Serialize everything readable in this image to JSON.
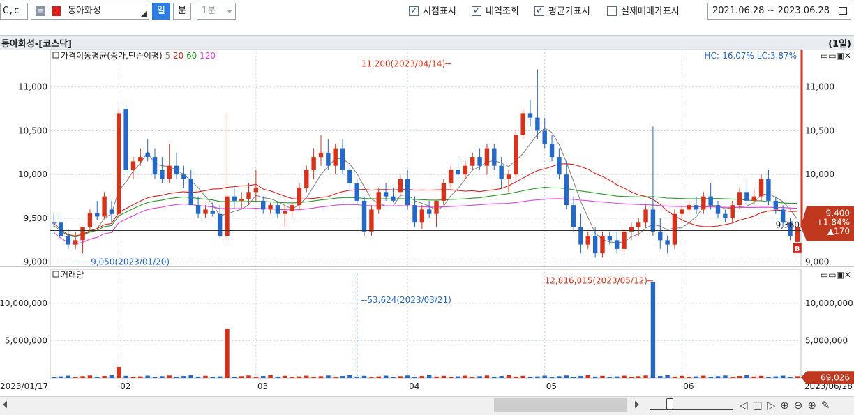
{
  "toolbar": {
    "code": "C,c",
    "stock_name": "동아화성",
    "btn_day": "일",
    "btn_min": "분",
    "interval": "1분",
    "checks": [
      {
        "label": "시점표시",
        "checked": true
      },
      {
        "label": "내역조회",
        "checked": true
      },
      {
        "label": "평균가표시",
        "checked": true
      },
      {
        "label": "실제매매가표시",
        "checked": false
      }
    ],
    "date_range": "2021.06.28 ~ 2023.06.28"
  },
  "panel": {
    "title": "동아화성-[코스닥]",
    "period": "(1일)"
  },
  "colors": {
    "up": "#d6331c",
    "down": "#2468c8",
    "ma5": "#888888",
    "ma20": "#e02020",
    "ma60": "#2a9a2a",
    "ma120": "#e040e0",
    "accent": "#e8542a"
  },
  "chart_data": [
    {
      "type": "candlestick",
      "title": "",
      "legend_title": "가격이동평균(종가,단순이평)",
      "ma_periods": [
        "5",
        "20",
        "60",
        "120"
      ],
      "hc_lc": "HC:-16.07%  LC:3.87%",
      "y_ticks": [
        9000,
        9500,
        10000,
        10500,
        11000
      ],
      "y_tick_labels": [
        "9,000",
        "9,500",
        "10,000",
        "10,500",
        "11,000"
      ],
      "ylim": [
        8950,
        11420
      ],
      "x_start_label": "2023/01/17",
      "x_end_label": "2023/06/28",
      "month_labels": [
        {
          "label": "02",
          "idx": 9
        },
        {
          "label": "03",
          "idx": 28
        },
        {
          "label": "04",
          "idx": 49
        },
        {
          "label": "05",
          "idx": 68
        },
        {
          "label": "06",
          "idx": 87
        }
      ],
      "n_bars": 104,
      "max_annotation": {
        "text": "11,200(2023/04/14)",
        "idx": 55,
        "value": 11200
      },
      "min_annotation": {
        "text": "9,050(2023/01/20)",
        "idx": 3,
        "value": 9050
      },
      "last_price_label": "9,360",
      "last_price": 9360,
      "current_box": [
        "9,400",
        "+1.84%",
        "▲170"
      ],
      "current_price": 9400,
      "buy_marker": "B",
      "candles": [
        [
          9450,
          9550,
          9400,
          9440
        ],
        [
          9450,
          9550,
          9260,
          9300
        ],
        [
          9300,
          9380,
          9150,
          9200
        ],
        [
          9200,
          9350,
          9150,
          9250
        ],
        [
          9250,
          9400,
          9100,
          9400
        ],
        [
          9400,
          9600,
          9350,
          9560
        ],
        [
          9560,
          9700,
          9480,
          9520
        ],
        [
          9520,
          9800,
          9500,
          9750
        ],
        [
          9600,
          9700,
          9450,
          9550
        ],
        [
          9550,
          10750,
          9500,
          10700
        ],
        [
          10750,
          10800,
          10000,
          10050
        ],
        [
          10050,
          10200,
          9950,
          10150
        ],
        [
          10150,
          10300,
          10100,
          10200
        ],
        [
          10250,
          10400,
          10150,
          10200
        ],
        [
          10200,
          10300,
          9950,
          10000
        ],
        [
          10050,
          10200,
          9900,
          9950
        ],
        [
          9950,
          10350,
          9900,
          10100
        ],
        [
          10100,
          10250,
          9950,
          10000
        ],
        [
          10000,
          10100,
          9850,
          9950
        ],
        [
          9950,
          10050,
          9750,
          9650
        ],
        [
          9650,
          9750,
          9500,
          9550
        ],
        [
          9550,
          9650,
          9500,
          9600
        ],
        [
          9580,
          9680,
          9520,
          9550
        ],
        [
          9550,
          9650,
          9280,
          9300
        ],
        [
          9300,
          10700,
          9250,
          9750
        ],
        [
          9750,
          9850,
          9600,
          9700
        ],
        [
          9700,
          9800,
          9600,
          9720
        ],
        [
          9720,
          9900,
          9650,
          9800
        ],
        [
          9800,
          10050,
          9700,
          9850
        ],
        [
          9700,
          9750,
          9550,
          9600
        ],
        [
          9600,
          9680,
          9550,
          9650
        ],
        [
          9650,
          9700,
          9500,
          9550
        ],
        [
          9550,
          9650,
          9400,
          9580
        ],
        [
          9580,
          9700,
          9500,
          9650
        ],
        [
          9650,
          9900,
          9600,
          9850
        ],
        [
          9850,
          10100,
          9800,
          10050
        ],
        [
          10050,
          10300,
          9950,
          10200
        ],
        [
          10200,
          10450,
          10100,
          10250
        ],
        [
          10250,
          10400,
          10050,
          10100
        ],
        [
          10100,
          10350,
          10000,
          10300
        ],
        [
          10300,
          10400,
          10000,
          10050
        ],
        [
          10050,
          10100,
          9800,
          9900
        ],
        [
          9900,
          9950,
          9650,
          9700
        ],
        [
          9700,
          9750,
          9300,
          9350
        ],
        [
          9350,
          9650,
          9300,
          9600
        ],
        [
          9600,
          9850,
          9550,
          9800
        ],
        [
          9800,
          9900,
          9700,
          9750
        ],
        [
          9750,
          9850,
          9680,
          9700
        ],
        [
          9800,
          10000,
          9750,
          9950
        ],
        [
          9950,
          10050,
          9600,
          9650
        ],
        [
          9650,
          9750,
          9400,
          9450
        ],
        [
          9450,
          9650,
          9380,
          9600
        ],
        [
          9600,
          9700,
          9500,
          9550
        ],
        [
          9550,
          9700,
          9400,
          9700
        ],
        [
          9700,
          9950,
          9650,
          9900
        ],
        [
          9900,
          10100,
          9850,
          10050
        ],
        [
          10050,
          10200,
          9950,
          10000
        ],
        [
          10000,
          10150,
          9950,
          10100
        ],
        [
          10100,
          10250,
          10050,
          10200
        ],
        [
          10200,
          10300,
          10050,
          10100
        ],
        [
          10100,
          10350,
          10000,
          10300
        ],
        [
          10300,
          10350,
          10050,
          10100
        ],
        [
          10100,
          10200,
          9850,
          9950
        ],
        [
          9950,
          10050,
          9800,
          10000
        ],
        [
          10000,
          10500,
          9950,
          10450
        ],
        [
          10450,
          10750,
          10400,
          10700
        ],
        [
          10700,
          10850,
          10550,
          10650
        ],
        [
          10650,
          11200,
          10400,
          10500
        ],
        [
          10500,
          10650,
          10300,
          10350
        ],
        [
          10350,
          10450,
          10150,
          10200
        ],
        [
          10200,
          10300,
          9950,
          10000
        ],
        [
          10000,
          10150,
          9600,
          9650
        ],
        [
          9650,
          9750,
          9350,
          9400
        ],
        [
          9400,
          9550,
          9100,
          9200
        ],
        [
          9200,
          9350,
          9150,
          9300
        ],
        [
          9300,
          9400,
          9050,
          9100
        ],
        [
          9100,
          9350,
          9050,
          9300
        ],
        [
          9300,
          9350,
          9200,
          9250
        ],
        [
          9250,
          9350,
          9100,
          9150
        ],
        [
          9150,
          9400,
          9100,
          9350
        ],
        [
          9350,
          9450,
          9250,
          9400
        ],
        [
          9400,
          9500,
          9300,
          9450
        ],
        [
          9450,
          9650,
          9400,
          9600
        ],
        [
          9600,
          10550,
          9300,
          9350
        ],
        [
          9350,
          9500,
          9150,
          9250
        ],
        [
          9250,
          9300,
          9100,
          9200
        ],
        [
          9200,
          9600,
          9150,
          9550
        ],
        [
          9550,
          9650,
          9500,
          9600
        ],
        [
          9600,
          9700,
          9550,
          9650
        ],
        [
          9650,
          9750,
          9550,
          9600
        ],
        [
          9600,
          9800,
          9550,
          9750
        ],
        [
          9750,
          9900,
          9600,
          9650
        ],
        [
          9650,
          9700,
          9500,
          9550
        ],
        [
          9550,
          9600,
          9450,
          9500
        ],
        [
          9500,
          9700,
          9450,
          9650
        ],
        [
          9650,
          9850,
          9600,
          9800
        ],
        [
          9800,
          9900,
          9650,
          9700
        ],
        [
          9700,
          9850,
          9650,
          9750
        ],
        [
          9750,
          10000,
          9700,
          9950
        ],
        [
          9950,
          10050,
          9650,
          9700
        ],
        [
          9700,
          9750,
          9550,
          9600
        ],
        [
          9600,
          9650,
          9400,
          9450
        ],
        [
          9450,
          9500,
          9250,
          9300
        ],
        [
          9230,
          9400,
          9200,
          9400
        ]
      ]
    },
    {
      "type": "bar",
      "title": "",
      "legend_title": "거래량",
      "y_ticks": [
        5000000,
        10000000
      ],
      "y_tick_labels": [
        "5,000,000",
        "10,000,000"
      ],
      "ylim": [
        0,
        14000000
      ],
      "max_annotation": {
        "text": "12,816,015(2023/05/12)",
        "idx": 83,
        "value": 12816015
      },
      "min_annotation": {
        "text": "53,624(2023/03/21)",
        "idx": 42,
        "value": 53624
      },
      "current_box": "69,026",
      "current_volume": 69026,
      "volume_spikes": [
        {
          "idx": 9,
          "value": 1500000
        },
        {
          "idx": 24,
          "value": 6600000
        },
        {
          "idx": 83,
          "value": 12816015
        }
      ],
      "base_volume": 250000
    }
  ]
}
